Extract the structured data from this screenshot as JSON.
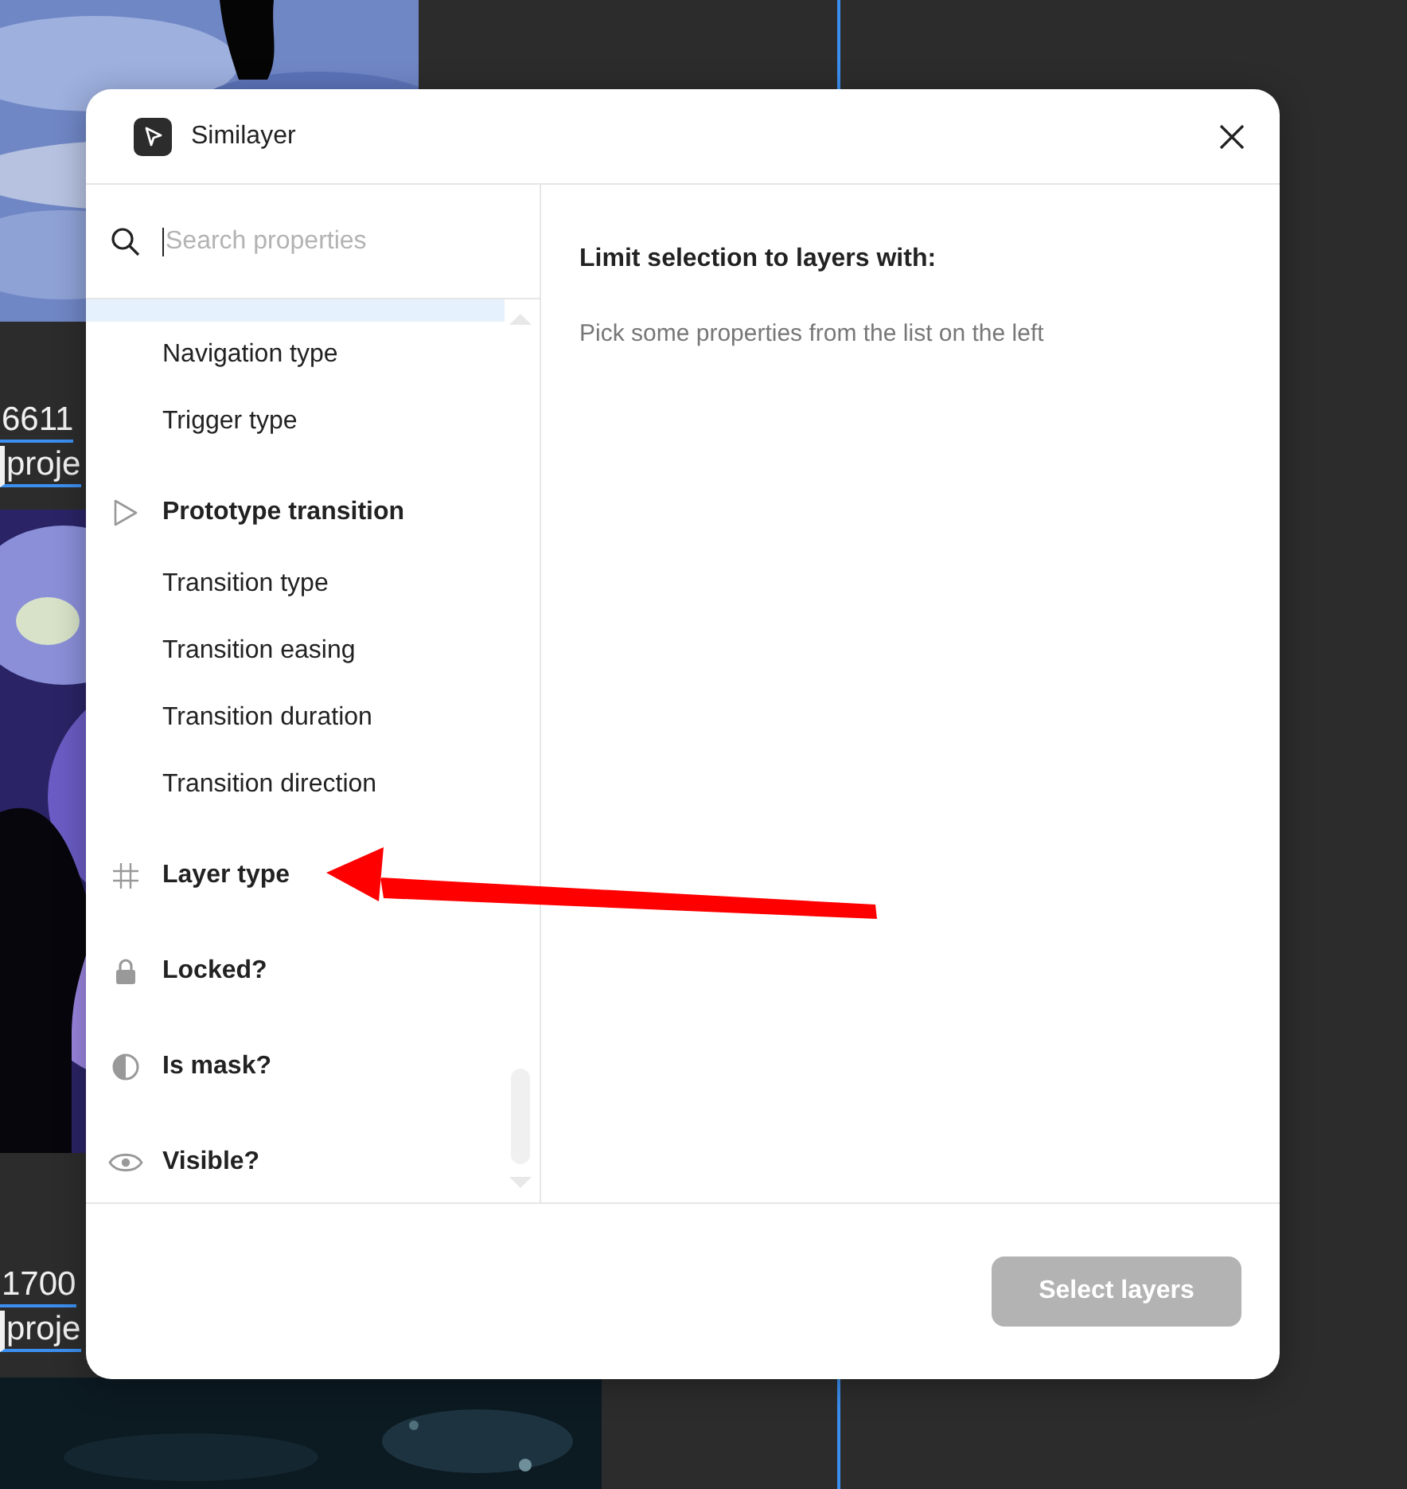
{
  "canvas": {
    "frame_labels": [
      {
        "number": "6611",
        "name": "proje"
      },
      {
        "number": "1700",
        "name": "proje"
      }
    ]
  },
  "dialog": {
    "title": "Similayer",
    "search": {
      "placeholder": "Search properties"
    },
    "properties": [
      {
        "kind": "partial",
        "selected": true
      },
      {
        "kind": "property",
        "label": "Navigation type",
        "selected": false
      },
      {
        "kind": "property",
        "label": "Trigger type",
        "selected": false
      },
      {
        "kind": "group",
        "label": "Prototype transition",
        "selected": false
      },
      {
        "kind": "property",
        "label": "Transition type",
        "selected": false
      },
      {
        "kind": "property",
        "label": "Transition easing",
        "selected": false
      },
      {
        "kind": "property",
        "label": "Transition duration",
        "selected": false
      },
      {
        "kind": "property",
        "label": "Transition direction",
        "selected": false
      },
      {
        "kind": "group",
        "label": "Layer type",
        "selected": false
      },
      {
        "kind": "group",
        "label": "Locked?",
        "selected": false
      },
      {
        "kind": "group",
        "label": "Is mask?",
        "selected": false
      },
      {
        "kind": "group",
        "label": "Visible?",
        "selected": false
      }
    ],
    "panel": {
      "heading": "Limit selection to layers with:",
      "hint": "Pick some properties from the list on the left"
    },
    "buttons": [
      {
        "label": "Select layers",
        "disabled": true
      }
    ]
  }
}
